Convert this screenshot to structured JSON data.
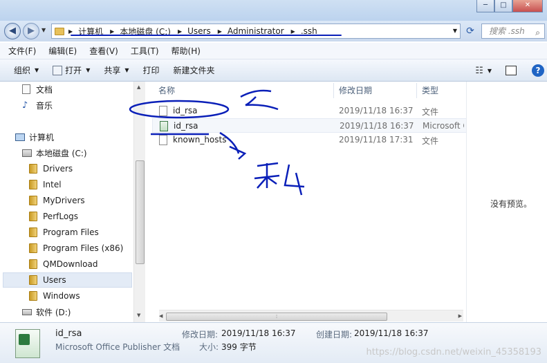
{
  "window": {
    "controls": [
      "─",
      "□",
      "✕"
    ]
  },
  "address": {
    "crumbs": [
      "计算机",
      "本地磁盘 (C:)",
      "Users",
      "Administrator",
      ".ssh"
    ],
    "search_placeholder": "搜索 .ssh"
  },
  "menu": [
    "文件(F)",
    "编辑(E)",
    "查看(V)",
    "工具(T)",
    "帮助(H)"
  ],
  "toolbar": {
    "organize": "组织",
    "open": "打开",
    "share": "共享",
    "print": "打印",
    "new_folder": "新建文件夹"
  },
  "nav": {
    "libraries": [
      {
        "label": "文档"
      },
      {
        "label": "音乐"
      }
    ],
    "computer": "计算机",
    "drive_c": "本地磁盘 (C:)",
    "folders": [
      "Drivers",
      "Intel",
      "MyDrivers",
      "PerfLogs",
      "Program Files",
      "Program Files (x86)",
      "QMDownload",
      "Users",
      "Windows"
    ],
    "drive_d": "软件 (D:)"
  },
  "columns": {
    "name": "名称",
    "modified": "修改日期",
    "type": "类型"
  },
  "files": [
    {
      "name": "id_rsa",
      "modified": "2019/11/18 16:37",
      "type": "文件"
    },
    {
      "name": "id_rsa",
      "modified": "2019/11/18 16:37",
      "type": "Microsoft O"
    },
    {
      "name": "known_hosts",
      "modified": "2019/11/18 17:31",
      "type": "文件"
    }
  ],
  "preview": {
    "empty_text": "没有预览。"
  },
  "details": {
    "name": "id_rsa",
    "type": "Microsoft Office Publisher 文档",
    "modified_label": "修改日期:",
    "modified_value": "2019/11/18 16:37",
    "size_label": "大小:",
    "size_value": "399 字节",
    "created_label": "创建日期:",
    "created_value": "2019/11/18 16:37"
  },
  "watermark": "https://blog.csdn.net/weixin_45358193",
  "colors": {
    "ink": "#0a1fb8",
    "selection": "#e3ebf6"
  }
}
